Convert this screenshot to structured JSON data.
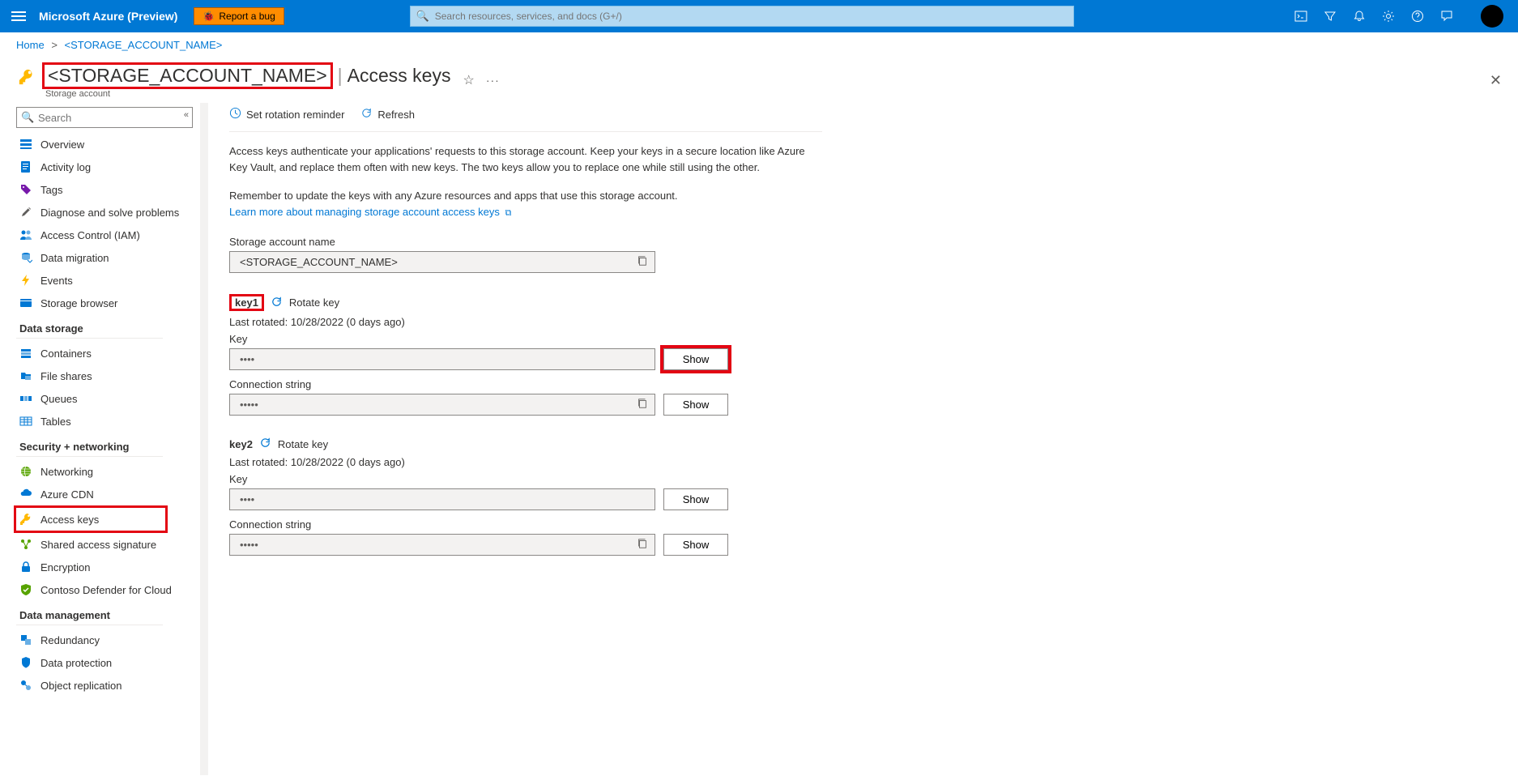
{
  "topbar": {
    "brand": "Microsoft Azure (Preview)",
    "report_bug": "Report a bug",
    "search_placeholder": "Search resources, services, and docs (G+/)"
  },
  "breadcrumb": {
    "home": "Home",
    "current": "<STORAGE_ACCOUNT_NAME>"
  },
  "header": {
    "title_account": "<STORAGE_ACCOUNT_NAME>",
    "title_section": "Access keys",
    "subtitle": "Storage account"
  },
  "sidebar": {
    "search_placeholder": "Search",
    "groups": [
      {
        "items": [
          {
            "icon": "overview",
            "label": "Overview",
            "color": "#0078d4"
          },
          {
            "icon": "activity",
            "label": "Activity log",
            "color": "#0078d4"
          },
          {
            "icon": "tags",
            "label": "Tags",
            "color": "#7719aa"
          },
          {
            "icon": "diagnose",
            "label": "Diagnose and solve problems",
            "color": "#605e5c"
          },
          {
            "icon": "iam",
            "label": "Access Control (IAM)",
            "color": "#0078d4"
          },
          {
            "icon": "datamigration",
            "label": "Data migration",
            "color": "#0078d4"
          },
          {
            "icon": "events",
            "label": "Events",
            "color": "#ffb900"
          },
          {
            "icon": "storagebrowser",
            "label": "Storage browser",
            "color": "#0078d4"
          }
        ]
      },
      {
        "title": "Data storage",
        "items": [
          {
            "icon": "containers",
            "label": "Containers",
            "color": "#0078d4"
          },
          {
            "icon": "fileshares",
            "label": "File shares",
            "color": "#0078d4"
          },
          {
            "icon": "queues",
            "label": "Queues",
            "color": "#0078d4"
          },
          {
            "icon": "tables",
            "label": "Tables",
            "color": "#0078d4"
          }
        ]
      },
      {
        "title": "Security + networking",
        "items": [
          {
            "icon": "networking",
            "label": "Networking",
            "color": "#2e8b57"
          },
          {
            "icon": "cdn",
            "label": "Azure CDN",
            "color": "#0078d4"
          },
          {
            "icon": "accesskeys",
            "label": "Access keys",
            "color": "#ffb900",
            "highlighted": true
          },
          {
            "icon": "sas",
            "label": "Shared access signature",
            "color": "#2e8b57"
          },
          {
            "icon": "encryption",
            "label": "Encryption",
            "color": "#0078d4"
          },
          {
            "icon": "defender",
            "label": "Contoso Defender for Cloud",
            "color": "#2e8b57"
          }
        ]
      },
      {
        "title": "Data management",
        "items": [
          {
            "icon": "redundancy",
            "label": "Redundancy",
            "color": "#0078d4"
          },
          {
            "icon": "dataprotection",
            "label": "Data protection",
            "color": "#0078d4"
          },
          {
            "icon": "objectrepl",
            "label": "Object replication",
            "color": "#0078d4"
          }
        ]
      }
    ]
  },
  "cmdbar": {
    "set_reminder": "Set rotation reminder",
    "refresh": "Refresh"
  },
  "description": {
    "p1": "Access keys authenticate your applications' requests to this storage account. Keep your keys in a secure location like Azure Key Vault, and replace them often with new keys. The two keys allow you to replace one while still using the other.",
    "p2": "Remember to update the keys with any Azure resources and apps that use this storage account.",
    "link_text": "Learn more about managing storage account access keys"
  },
  "account_name": {
    "label": "Storage account name",
    "value": "<STORAGE_ACCOUNT_NAME>"
  },
  "keys": [
    {
      "name": "key1",
      "highlighted": true,
      "rotate_label": "Rotate key",
      "last_rotated": "Last rotated: 10/28/2022 (0 days ago)",
      "key_label": "Key",
      "key_value": "••••",
      "conn_label": "Connection string",
      "conn_value": "•••••",
      "show_highlighted": true
    },
    {
      "name": "key2",
      "highlighted": false,
      "rotate_label": "Rotate key",
      "last_rotated": "Last rotated: 10/28/2022 (0 days ago)",
      "key_label": "Key",
      "key_value": "••••",
      "conn_label": "Connection string",
      "conn_value": "•••••",
      "show_highlighted": false
    }
  ],
  "show_label": "Show"
}
